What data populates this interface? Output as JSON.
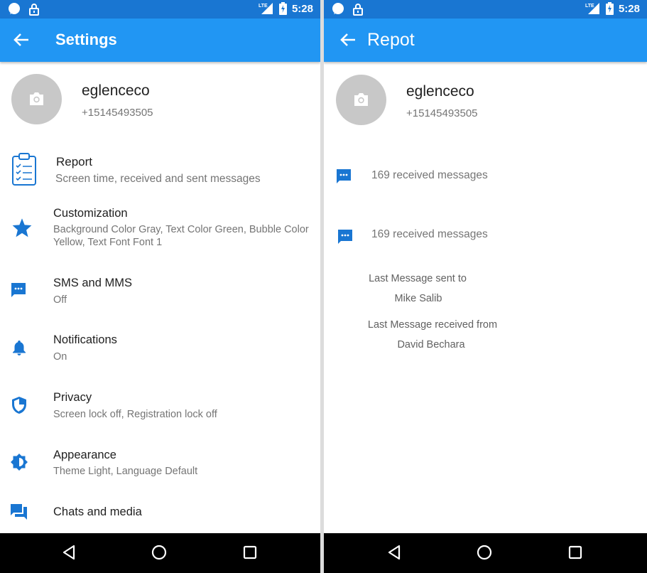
{
  "status_bar": {
    "time": "5:28",
    "network": "LTE"
  },
  "settings_screen": {
    "title": "Settings",
    "profile": {
      "name": "eglenceco",
      "phone": "+15145493505"
    },
    "items": [
      {
        "label": "Report",
        "sub": "Screen time, received and sent messages",
        "icon": "clipboard-checklist-icon"
      },
      {
        "label": "Customization",
        "sub": "Background Color Gray, Text Color Green, Bubble Color Yellow, Text Font Font 1",
        "icon": "star-icon"
      },
      {
        "label": "SMS and MMS",
        "sub": "Off",
        "icon": "message-icon"
      },
      {
        "label": "Notifications",
        "sub": "On",
        "icon": "bell-icon"
      },
      {
        "label": "Privacy",
        "sub": "Screen lock off, Registration lock off",
        "icon": "shield-icon"
      },
      {
        "label": "Appearance",
        "sub": "Theme Light, Language Default",
        "icon": "brightness-icon"
      },
      {
        "label": "Chats and media",
        "sub": "",
        "icon": "chat-icon"
      }
    ]
  },
  "report_screen": {
    "title": "Repot",
    "profile": {
      "name": "eglenceco",
      "phone": "+15145493505"
    },
    "rows": [
      {
        "text": "169 received messages"
      },
      {
        "text": "169 received messages"
      }
    ],
    "last_sent_label": "Last Message sent to",
    "last_sent_name": "Mike Salib",
    "last_received_label": "Last Message received from",
    "last_received_name": "David Bechara"
  },
  "colors": {
    "status_bar": "#1976d2",
    "app_bar": "#2196f3",
    "icon_blue": "#1976d2",
    "nav_bar": "#000000"
  }
}
